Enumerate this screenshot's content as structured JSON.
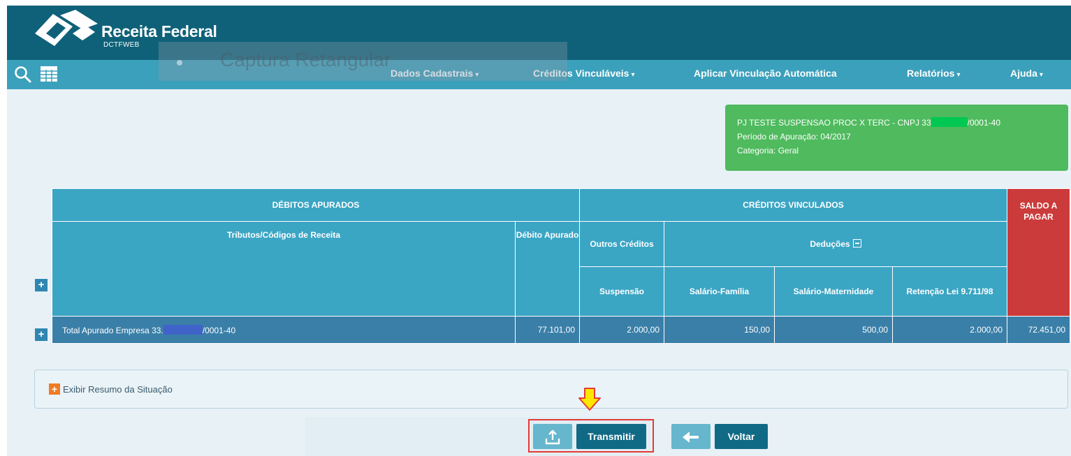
{
  "header": {
    "brand": "Receita Federal",
    "sub": "DCTFWEB"
  },
  "nav": {
    "items": [
      {
        "label": "Dados Cadastrais",
        "caret": "▾"
      },
      {
        "label": "Créditos Vinculáveis",
        "caret": "▾"
      },
      {
        "label": "Aplicar Vinculação Automática",
        "caret": ""
      },
      {
        "label": "Relatórios",
        "caret": "▾"
      },
      {
        "label": "Ajuda",
        "caret": "▾"
      }
    ]
  },
  "overlay": {
    "text": "Captura Retangular"
  },
  "info": {
    "line1_prefix": "PJ TESTE SUSPENSAO PROC X TERC - CNPJ 33",
    "line1_suffix": "/0001-40",
    "line2": "Período de Apuração: 04/2017",
    "line3": "Categoria: Geral"
  },
  "table": {
    "group_debitos": "DÉBITOS APURADOS",
    "group_creditos": "CRÉDITOS VINCULADOS",
    "saldo_header": "SALDO A PAGAR",
    "col_tributos": "Tributos/Códigos de Receita",
    "col_debito": "Débito Apurado",
    "col_outros": "Outros Créditos",
    "col_deducoes": "Deduções",
    "col_suspensao": "Suspensão",
    "col_salario_familia": "Salário-Família",
    "col_salario_maternidade": "Salário-Maternidade",
    "col_retencao": "Retenção Lei 9.711/98",
    "total_row": {
      "label_prefix": "Total Apurado Empresa 33.",
      "label_suffix": "/0001-40",
      "debito": "77.101,00",
      "suspensao": "2.000,00",
      "salario_familia": "150,00",
      "salario_maternidade": "500,00",
      "retencao": "2.000,00",
      "saldo": "72.451,00"
    }
  },
  "resumo": {
    "label": "Exibir Resumo da Situação"
  },
  "buttons": {
    "transmitir": "Transmitir",
    "voltar": "Voltar"
  },
  "colors": {
    "header_bg": "#0e6178",
    "nav_bg": "#3ba0bb",
    "table_header": "#3ba5c4",
    "total_row": "#3a7fa8",
    "saldo": "#cc3b3b",
    "info_box": "#4fba5e",
    "highlight": "#e53935",
    "arrow": "#ffe600"
  },
  "icons": [
    "logo-icon",
    "search-icon",
    "table-grid-icon",
    "expand-plus-icon",
    "collapse-minus-icon",
    "down-arrow-icon",
    "upload-icon",
    "back-arrow-icon"
  ]
}
